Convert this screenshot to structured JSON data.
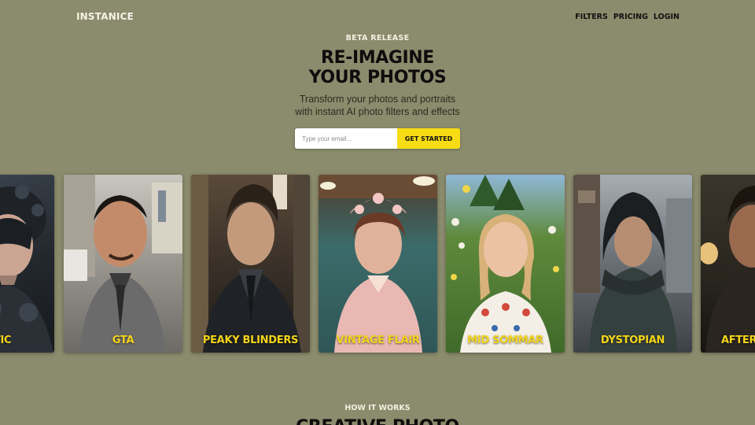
{
  "brand": {
    "logo": "INSTANICE"
  },
  "nav": {
    "items": [
      "FILTERS",
      "PRICING",
      "LOGIN"
    ]
  },
  "hero": {
    "badge": "BETA RELEASE",
    "title_line1": "RE-IMAGINE",
    "title_line2": "YOUR PHOTOS",
    "subtitle_line1": "Transform your photos and portraits",
    "subtitle_line2": "with instant AI photo filters and effects"
  },
  "signup": {
    "email_placeholder": "Type your email...",
    "email_value": "",
    "cta_label": "GET STARTED"
  },
  "filters": [
    {
      "label": "GENETIC",
      "visible_label": "NETIC"
    },
    {
      "label": "GTA"
    },
    {
      "label": "PEAKY BLINDERS"
    },
    {
      "label": "VINTAGE FLAIR"
    },
    {
      "label": "MID SOMMAR"
    },
    {
      "label": "DYSTOPIAN"
    },
    {
      "label": "AFTER",
      "visible_label": "AFTER"
    }
  ],
  "how_it_works": {
    "badge": "HOW IT WORKS",
    "title": "CREATIVE PHOTO"
  },
  "colors": {
    "background": "#8b8b6d",
    "accent_yellow": "#f7dc13",
    "card_label": "#f4d51a",
    "heading": "#0d0d0d"
  }
}
